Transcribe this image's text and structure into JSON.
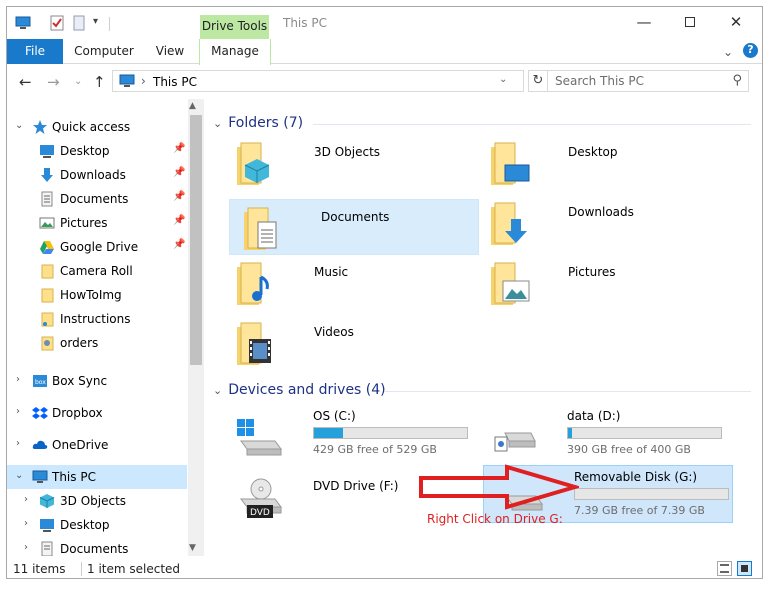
{
  "titlebar": {
    "context_tab": "Drive Tools",
    "title": "This PC",
    "minimize_icon": "minimize-icon",
    "maximize_icon": "maximize-icon",
    "close_icon": "close-icon"
  },
  "ribbon": {
    "tabs": [
      {
        "label": "File"
      },
      {
        "label": "Computer"
      },
      {
        "label": "View"
      },
      {
        "label": "Manage"
      }
    ],
    "expand_icon": "chevron-down-icon",
    "help_icon": "help-icon"
  },
  "navigation": {
    "back_icon": "arrow-left-icon",
    "forward_icon": "arrow-right-icon",
    "recent_icon": "chevron-down-icon",
    "up_icon": "arrow-up-icon",
    "address": "This PC",
    "search_placeholder": "Search This PC"
  },
  "sidebar": {
    "quick_access": "Quick access",
    "quick_items": [
      {
        "label": "Desktop",
        "pinned": true
      },
      {
        "label": "Downloads",
        "pinned": true
      },
      {
        "label": "Documents",
        "pinned": true
      },
      {
        "label": "Pictures",
        "pinned": true
      },
      {
        "label": "Google Drive",
        "pinned": true
      },
      {
        "label": "Camera Roll",
        "pinned": false
      },
      {
        "label": "HowToImg",
        "pinned": false
      },
      {
        "label": "Instructions",
        "pinned": false
      },
      {
        "label": "orders",
        "pinned": false
      }
    ],
    "other_items": [
      {
        "label": "Box Sync"
      },
      {
        "label": "Dropbox"
      },
      {
        "label": "OneDrive"
      }
    ],
    "this_pc": "This PC",
    "this_pc_children": [
      {
        "label": "3D Objects"
      },
      {
        "label": "Desktop"
      },
      {
        "label": "Documents"
      }
    ]
  },
  "folders": {
    "header": "Folders (7)",
    "items": [
      {
        "label": "3D Objects",
        "icon": "3d-objects-folder-icon"
      },
      {
        "label": "Desktop",
        "icon": "desktop-folder-icon"
      },
      {
        "label": "Documents",
        "icon": "documents-folder-icon",
        "selected": true
      },
      {
        "label": "Downloads",
        "icon": "downloads-folder-icon"
      },
      {
        "label": "Music",
        "icon": "music-folder-icon"
      },
      {
        "label": "Pictures",
        "icon": "pictures-folder-icon"
      },
      {
        "label": "Videos",
        "icon": "videos-folder-icon"
      }
    ]
  },
  "drives": {
    "header": "Devices and drives (4)",
    "items": [
      {
        "name": "OS (C:)",
        "free_text": "429 GB free of 529 GB",
        "used_fraction": 0.19,
        "icon": "windows-drive-icon"
      },
      {
        "name": "data (D:)",
        "free_text": "390 GB free of 400 GB",
        "used_fraction": 0.025,
        "icon": "drive-icon"
      },
      {
        "name": "DVD Drive (F:)",
        "free_text": "",
        "used_fraction": null,
        "icon": "dvd-drive-icon",
        "badge": "DVD"
      },
      {
        "name": "Removable Disk (G:)",
        "free_text": "7.39 GB free of 7.39 GB",
        "used_fraction": 0.0,
        "icon": "usb-drive-icon",
        "selected": true
      }
    ]
  },
  "annotation": {
    "text": "Right Click on Drive G:",
    "color": "#e02020"
  },
  "statusbar": {
    "count": "11 items",
    "selected": "1 item selected"
  },
  "colors": {
    "accent": "#1979ca",
    "drive_tools_tab": "#bde8a3",
    "selection": "#cce8ff",
    "header_text": "#1e3287",
    "bar_fill": "#26a0da"
  }
}
